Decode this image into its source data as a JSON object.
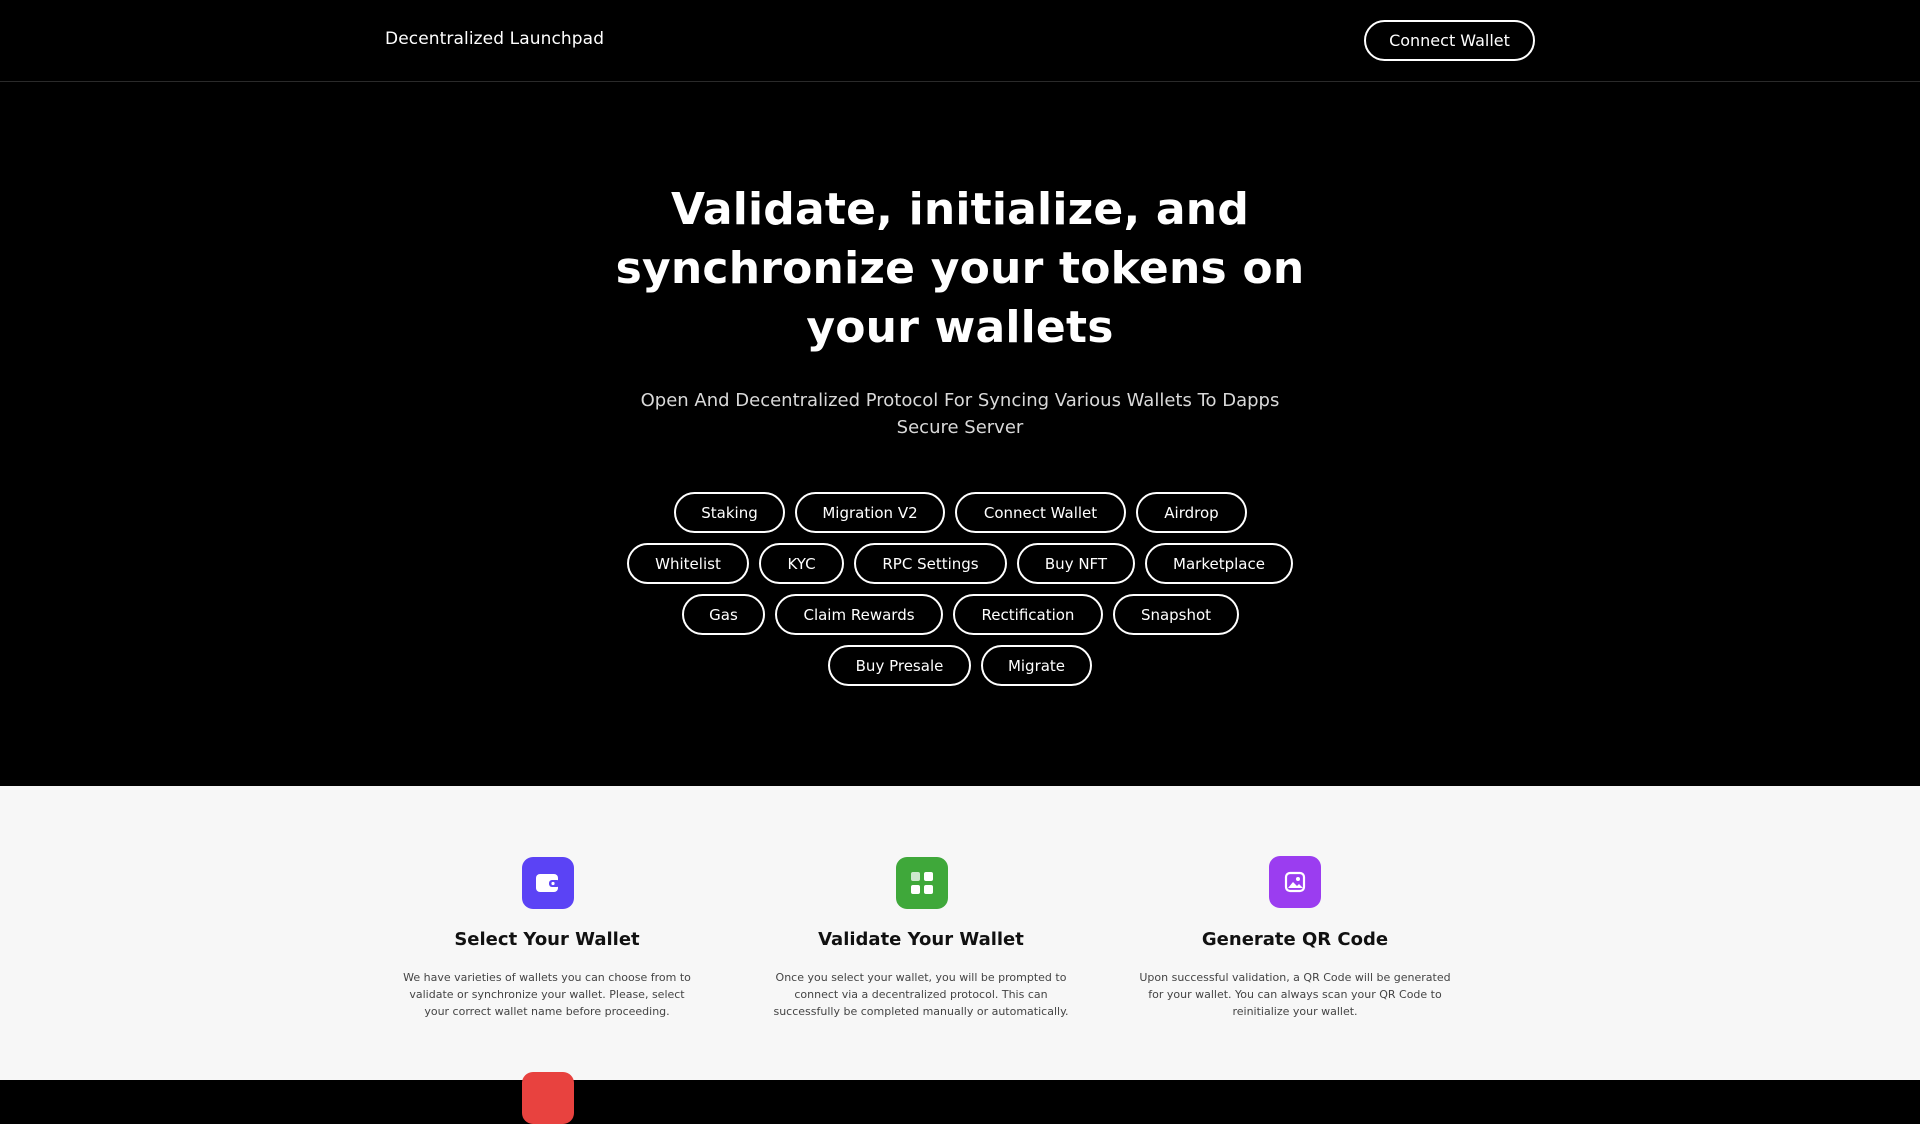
{
  "header": {
    "brand": "Decentralized Launchpad",
    "connect_label": "Connect Wallet"
  },
  "hero": {
    "title": "Validate, initialize, and synchronize your tokens on your wallets",
    "subtitle": "Open And Decentralized Protocol For Syncing Various Wallets To Dapps Secure Server",
    "chips": [
      "Staking",
      "Migration V2",
      "Connect Wallet",
      "Airdrop",
      "Whitelist",
      "KYC",
      "RPC Settings",
      "Buy NFT",
      "Marketplace",
      "Gas",
      "Claim Rewards",
      "Rectification",
      "Snapshot",
      "Buy Presale",
      "Migrate"
    ]
  },
  "steps": [
    {
      "title": "Select Your Wallet",
      "description": "We have varieties of wallets you can choose from to validate or synchronize your wallet. Please, select your correct wallet name before proceeding.",
      "icon": "wallet-icon",
      "color": "#5b43f5"
    },
    {
      "title": "Validate Your Wallet",
      "description": "Once you select your wallet, you will be prompted to connect via a decentralized protocol. This can successfully be completed manually or automatically.",
      "icon": "grid-icon",
      "color": "#3fa83a"
    },
    {
      "title": "Generate QR Code",
      "description": "Upon successful validation, a QR Code will be generated for your wallet. You can always scan your QR Code to reinitialize your wallet.",
      "icon": "image-icon",
      "color": "#9b3df0"
    }
  ],
  "colors": {
    "background": "#000000",
    "steps_background": "#f7f7f7",
    "accent_red": "#e8423f"
  }
}
